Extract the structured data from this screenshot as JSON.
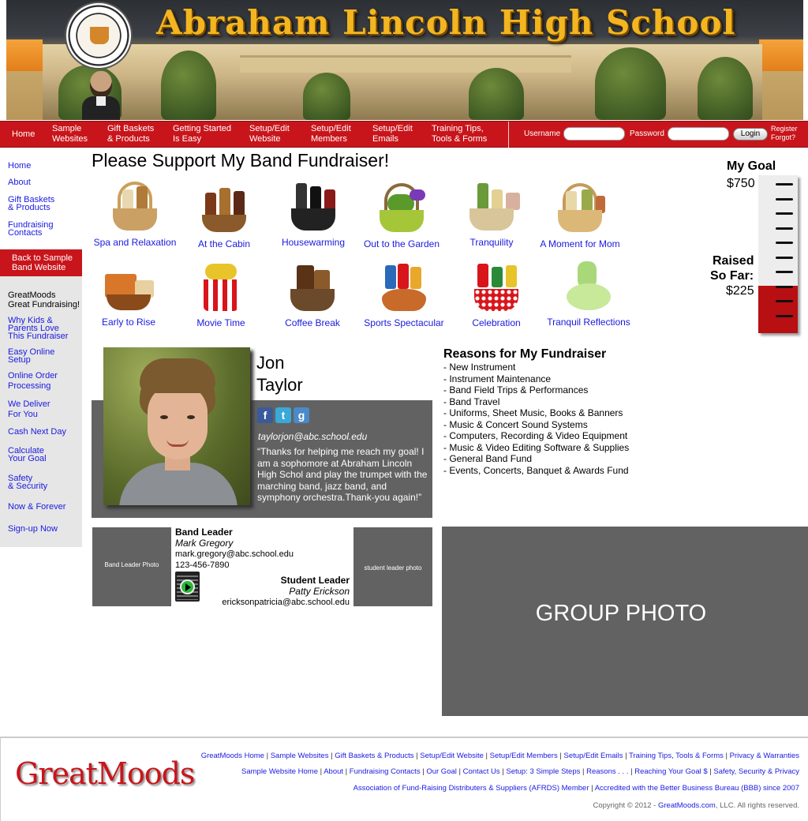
{
  "banner": {
    "title": "Abraham Lincoln High School"
  },
  "topnav": {
    "items": [
      {
        "label": "Home"
      },
      {
        "label": "Sample\nWebsites"
      },
      {
        "label": "Gift Baskets\n& Products"
      },
      {
        "label": "Getting Started\nIs Easy"
      },
      {
        "label": "Setup/Edit\nWebsite"
      },
      {
        "label": "Setup/Edit\nMembers"
      },
      {
        "label": "Setup/Edit\nEmails"
      },
      {
        "label": "Training Tips,\nTools & Forms"
      }
    ],
    "username_label": "Username",
    "password_label": "Password",
    "login_label": "Login",
    "register": "Register",
    "forgot": "Forgot?"
  },
  "sidebar": {
    "links_top": [
      "Home",
      "About",
      "Gift Baskets\n& Products",
      "Fundraising\nContacts"
    ],
    "back": "Back to Sample\nBand Website",
    "greatmoods": "GreatMoods\nGreat Fundraising!",
    "links_bottom": [
      "Why Kids &\nParents Love\nThis Fundraiser",
      "Easy Online\nSetup",
      "Online Order\nProcessing",
      "We Deliver\nFor You",
      "Cash Next Day",
      "Calculate\nYour Goal",
      "Safety\n& Security",
      "Now & Forever",
      "Sign-up Now"
    ]
  },
  "heading": "Please Support My Band Fundraiser!",
  "products": [
    {
      "label": "Spa and Relaxation"
    },
    {
      "label": "At the Cabin"
    },
    {
      "label": "Housewarming"
    },
    {
      "label": "Out to the Garden"
    },
    {
      "label": "Tranquility"
    },
    {
      "label": "A Moment for Mom"
    },
    {
      "label": "Early to Rise"
    },
    {
      "label": "Movie Time"
    },
    {
      "label": "Coffee Break"
    },
    {
      "label": "Sports Spectacular"
    },
    {
      "label": "Celebration"
    },
    {
      "label": "Tranquil Reflections"
    }
  ],
  "goal": {
    "title": "My Goal",
    "amount": "$750",
    "raised_label_1": "Raised",
    "raised_label_2": "So Far:",
    "raised_amount": "$225",
    "fill_fraction": 0.3,
    "fill_color": "#b80f12"
  },
  "student": {
    "first_name": "Jon",
    "last_name": "Taylor",
    "email": "taylorjon@abc.school.edu",
    "quote": "“Thanks for helping me reach my goal! I am a sophomore at Abraham Lincoln High Schol and play the trumpet with the marching band, jazz band, and symphony orchestra.Thank-you again!”",
    "social": [
      {
        "icon": "facebook-icon",
        "glyph": "f"
      },
      {
        "icon": "twitter-icon",
        "glyph": "t"
      },
      {
        "icon": "google-icon",
        "glyph": "g"
      }
    ]
  },
  "reasons": {
    "title": "Reasons for My Fundraiser",
    "items": [
      "- New Instrument",
      "- Instrument Maintenance",
      "- Band Field Trips & Performances",
      "- Band Travel",
      "- Uniforms, Sheet Music, Books & Banners",
      "- Music & Concert Sound Systems",
      "- Computers, Recording & Video Equipment",
      "- Music & Video Editing Software & Supplies",
      "- General Band Fund",
      "- Events, Concerts, Banquet & Awards Fund"
    ]
  },
  "leaders": {
    "band_photo": "Band Leader Photo",
    "band_title": "Band Leader",
    "band_name": "Mark Gregory",
    "band_email": "mark.gregory@abc.school.edu",
    "band_phone": "123-456-7890",
    "student_photo": "student leader photo",
    "student_title": "Student Leader",
    "student_name": "Patty Erickson",
    "student_email": "ericksonpatricia@abc.school.edu"
  },
  "group_photo": "GROUP PHOTO",
  "footer": {
    "logo": "GreatMoods",
    "row1": [
      "GreatMoods Home",
      "Sample Websites",
      "Gift Baskets & Products",
      "Setup/Edit Website",
      "Setup/Edit Members",
      "Setup/Edit Emails",
      "Training Tips, Tools & Forms",
      "Privacy & Warranties"
    ],
    "row2": [
      "Sample Website Home",
      "About",
      "Fundraising Contacts",
      "Our Goal",
      "Contact Us",
      "Setup: 3 Simple Steps",
      "Reasons . . .",
      "Reaching Your Goal $",
      "Safety, Security & Privacy"
    ],
    "row3": [
      "Association of Fund-Raising Distributers & Suppliers (AFRDS) Member",
      "Accredited with the Better Business Bureau (BBB) since 2007"
    ],
    "copyright_pre": "Copyright © 2012 - ",
    "copyright_link": "GreatMoods.com",
    "copyright_post": ", LLC. All rights reserved."
  }
}
